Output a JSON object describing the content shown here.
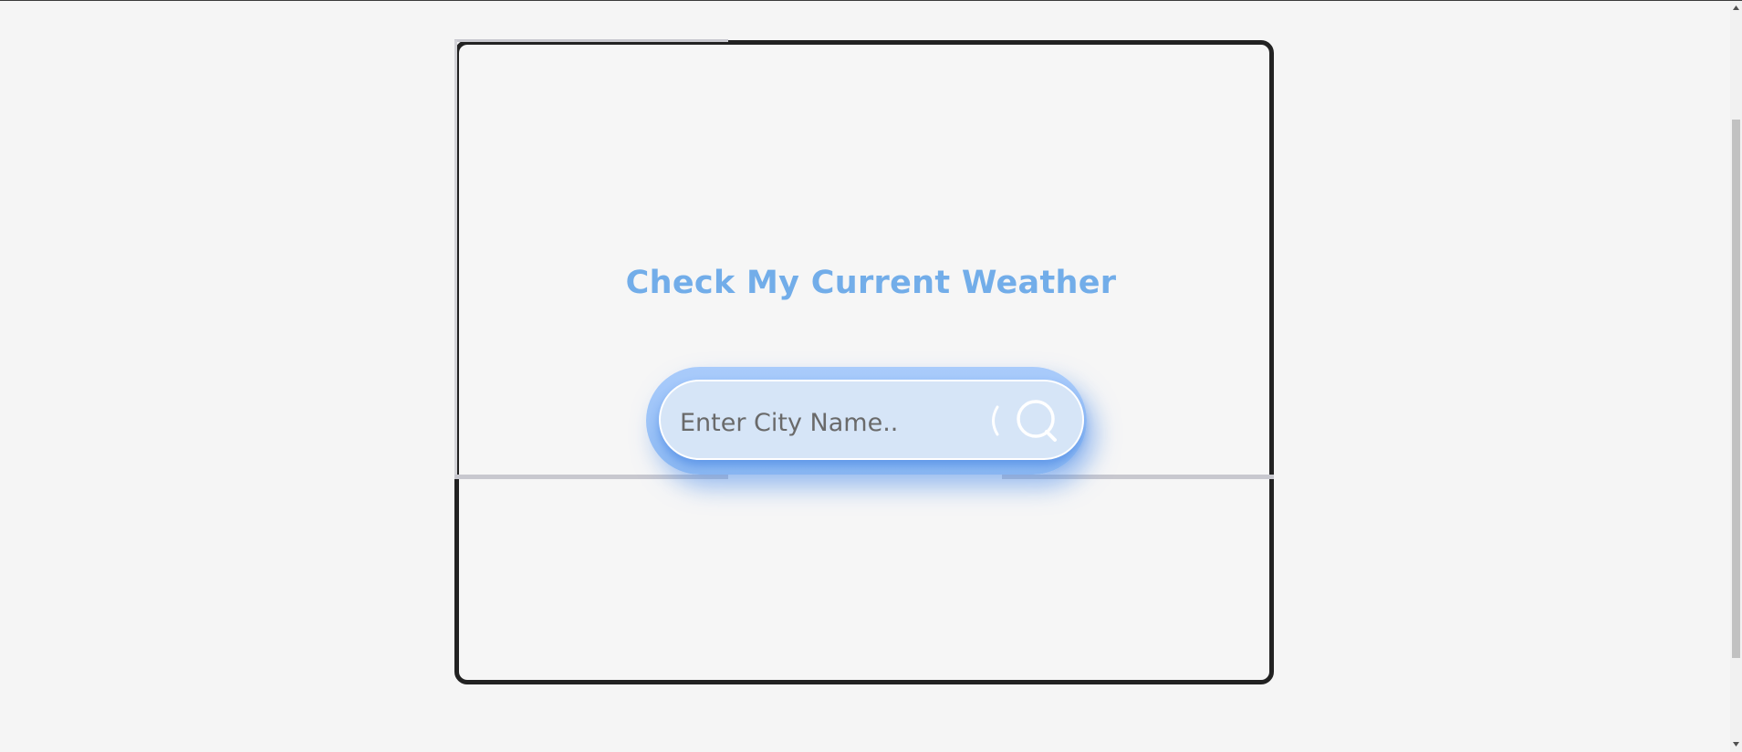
{
  "weather_app": {
    "title": "Check My Current Weather",
    "search": {
      "placeholder": "Enter City Name..",
      "value": "",
      "icon": "search-icon"
    }
  },
  "colors": {
    "title": "#72ade9",
    "card_border": "#222222",
    "search_outer": "#9cc3f7",
    "search_inner": "#d6e5f7",
    "background": "#f5f5f5"
  }
}
